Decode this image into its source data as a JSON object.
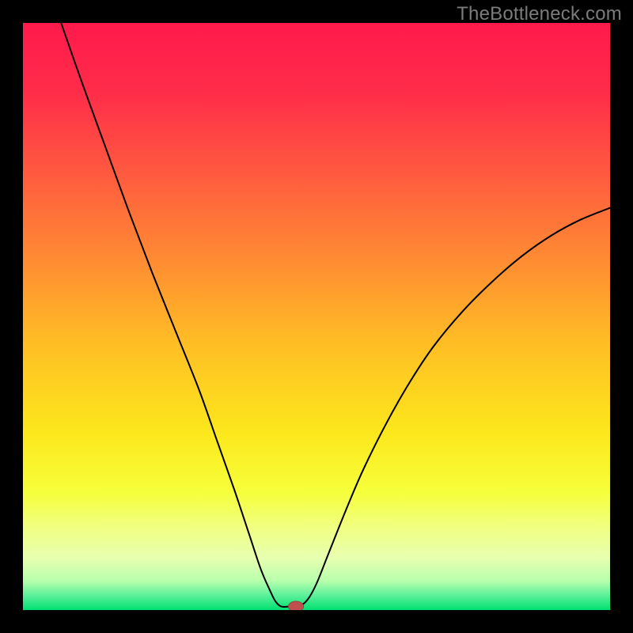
{
  "watermark": "TheBottleneck.com",
  "chart_data": {
    "type": "line",
    "title": "",
    "xlabel": "",
    "ylabel": "",
    "xlim": [
      0,
      100
    ],
    "ylim": [
      0,
      100
    ],
    "background_gradient": {
      "stops": [
        {
          "offset": 0.0,
          "color": "#ff1a4c"
        },
        {
          "offset": 0.12,
          "color": "#ff2d49"
        },
        {
          "offset": 0.25,
          "color": "#ff5840"
        },
        {
          "offset": 0.4,
          "color": "#ff8a33"
        },
        {
          "offset": 0.55,
          "color": "#ffbf24"
        },
        {
          "offset": 0.7,
          "color": "#fce81c"
        },
        {
          "offset": 0.8,
          "color": "#f6ff3b"
        },
        {
          "offset": 0.86,
          "color": "#f0ff82"
        },
        {
          "offset": 0.91,
          "color": "#e8ffb0"
        },
        {
          "offset": 0.95,
          "color": "#b8ffac"
        },
        {
          "offset": 0.975,
          "color": "#5cf09a"
        },
        {
          "offset": 1.0,
          "color": "#00e070"
        }
      ]
    },
    "curve_points": [
      {
        "x": 6.5,
        "y": 100.0
      },
      {
        "x": 10.0,
        "y": 90.0
      },
      {
        "x": 14.0,
        "y": 79.0
      },
      {
        "x": 18.0,
        "y": 68.0
      },
      {
        "x": 22.0,
        "y": 57.5
      },
      {
        "x": 26.0,
        "y": 47.5
      },
      {
        "x": 30.0,
        "y": 37.5
      },
      {
        "x": 33.0,
        "y": 29.0
      },
      {
        "x": 36.0,
        "y": 20.5
      },
      {
        "x": 38.5,
        "y": 13.0
      },
      {
        "x": 40.5,
        "y": 7.0
      },
      {
        "x": 42.0,
        "y": 3.5
      },
      {
        "x": 43.0,
        "y": 1.5
      },
      {
        "x": 44.0,
        "y": 0.6
      },
      {
        "x": 45.5,
        "y": 0.6
      },
      {
        "x": 47.0,
        "y": 0.6
      },
      {
        "x": 48.5,
        "y": 1.8
      },
      {
        "x": 50.0,
        "y": 4.5
      },
      {
        "x": 52.0,
        "y": 9.5
      },
      {
        "x": 55.0,
        "y": 17.0
      },
      {
        "x": 58.0,
        "y": 24.0
      },
      {
        "x": 62.0,
        "y": 32.0
      },
      {
        "x": 66.0,
        "y": 39.0
      },
      {
        "x": 70.0,
        "y": 45.0
      },
      {
        "x": 75.0,
        "y": 51.0
      },
      {
        "x": 80.0,
        "y": 56.0
      },
      {
        "x": 85.0,
        "y": 60.3
      },
      {
        "x": 90.0,
        "y": 63.8
      },
      {
        "x": 95.0,
        "y": 66.5
      },
      {
        "x": 100.0,
        "y": 68.5
      }
    ],
    "marker": {
      "x": 46.5,
      "y": 0.6,
      "rx": 1.3,
      "ry": 0.9,
      "color": "#c0504d"
    }
  }
}
